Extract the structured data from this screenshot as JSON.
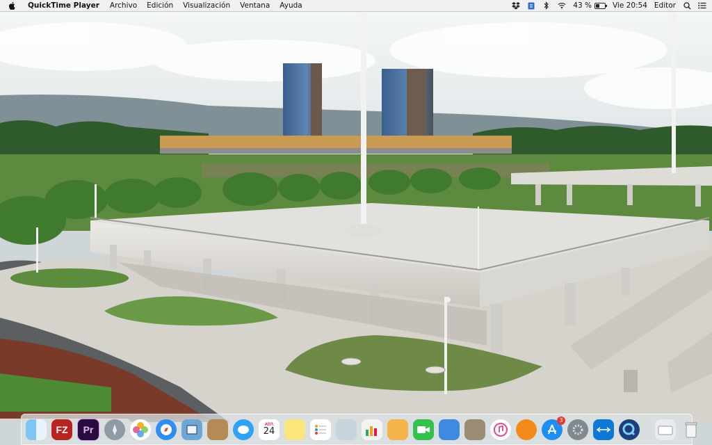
{
  "menubar": {
    "app_name": "QuickTime Player",
    "menus": [
      "Archivo",
      "Edición",
      "Visualización",
      "Ventana",
      "Ayuda"
    ],
    "battery_percent": "43 %",
    "battery_level": 0.43,
    "clock": "Vie 20:54",
    "user": "Editor"
  },
  "dock": {
    "items": [
      {
        "name": "finder-icon",
        "label": ""
      },
      {
        "name": "filezilla-icon",
        "label": "FZ"
      },
      {
        "name": "premiere-icon",
        "label": "Pr"
      },
      {
        "name": "launchpad-icon",
        "label": ""
      },
      {
        "name": "photos-icon",
        "label": ""
      },
      {
        "name": "safari-icon",
        "label": ""
      },
      {
        "name": "preview-icon",
        "label": ""
      },
      {
        "name": "notes-book-icon",
        "label": ""
      },
      {
        "name": "messages-icon",
        "label": ""
      },
      {
        "name": "calendar-icon",
        "label": "24"
      },
      {
        "name": "notes-icon",
        "label": ""
      },
      {
        "name": "reminders-icon",
        "label": ""
      },
      {
        "name": "photo-booth-icon",
        "label": ""
      },
      {
        "name": "numbers-icon",
        "label": ""
      },
      {
        "name": "pages-icon",
        "label": ""
      },
      {
        "name": "facetime-icon",
        "label": ""
      },
      {
        "name": "keynote-icon",
        "label": ""
      },
      {
        "name": "chess-icon",
        "label": ""
      },
      {
        "name": "itunes-icon",
        "label": ""
      },
      {
        "name": "ibooks-icon",
        "label": ""
      },
      {
        "name": "app-store-icon",
        "label": ""
      },
      {
        "name": "system-preferences-icon",
        "label": ""
      },
      {
        "name": "teamviewer-icon",
        "label": ""
      },
      {
        "name": "quicktime-icon",
        "label": ""
      }
    ],
    "app_store_badge": "3",
    "calendar_month": "ABR"
  },
  "colors": {
    "menubar_bg": "#f1f1f1",
    "sky": "#e9eef1",
    "grass": "#4c7f38",
    "concrete": "#d9d6d0"
  }
}
